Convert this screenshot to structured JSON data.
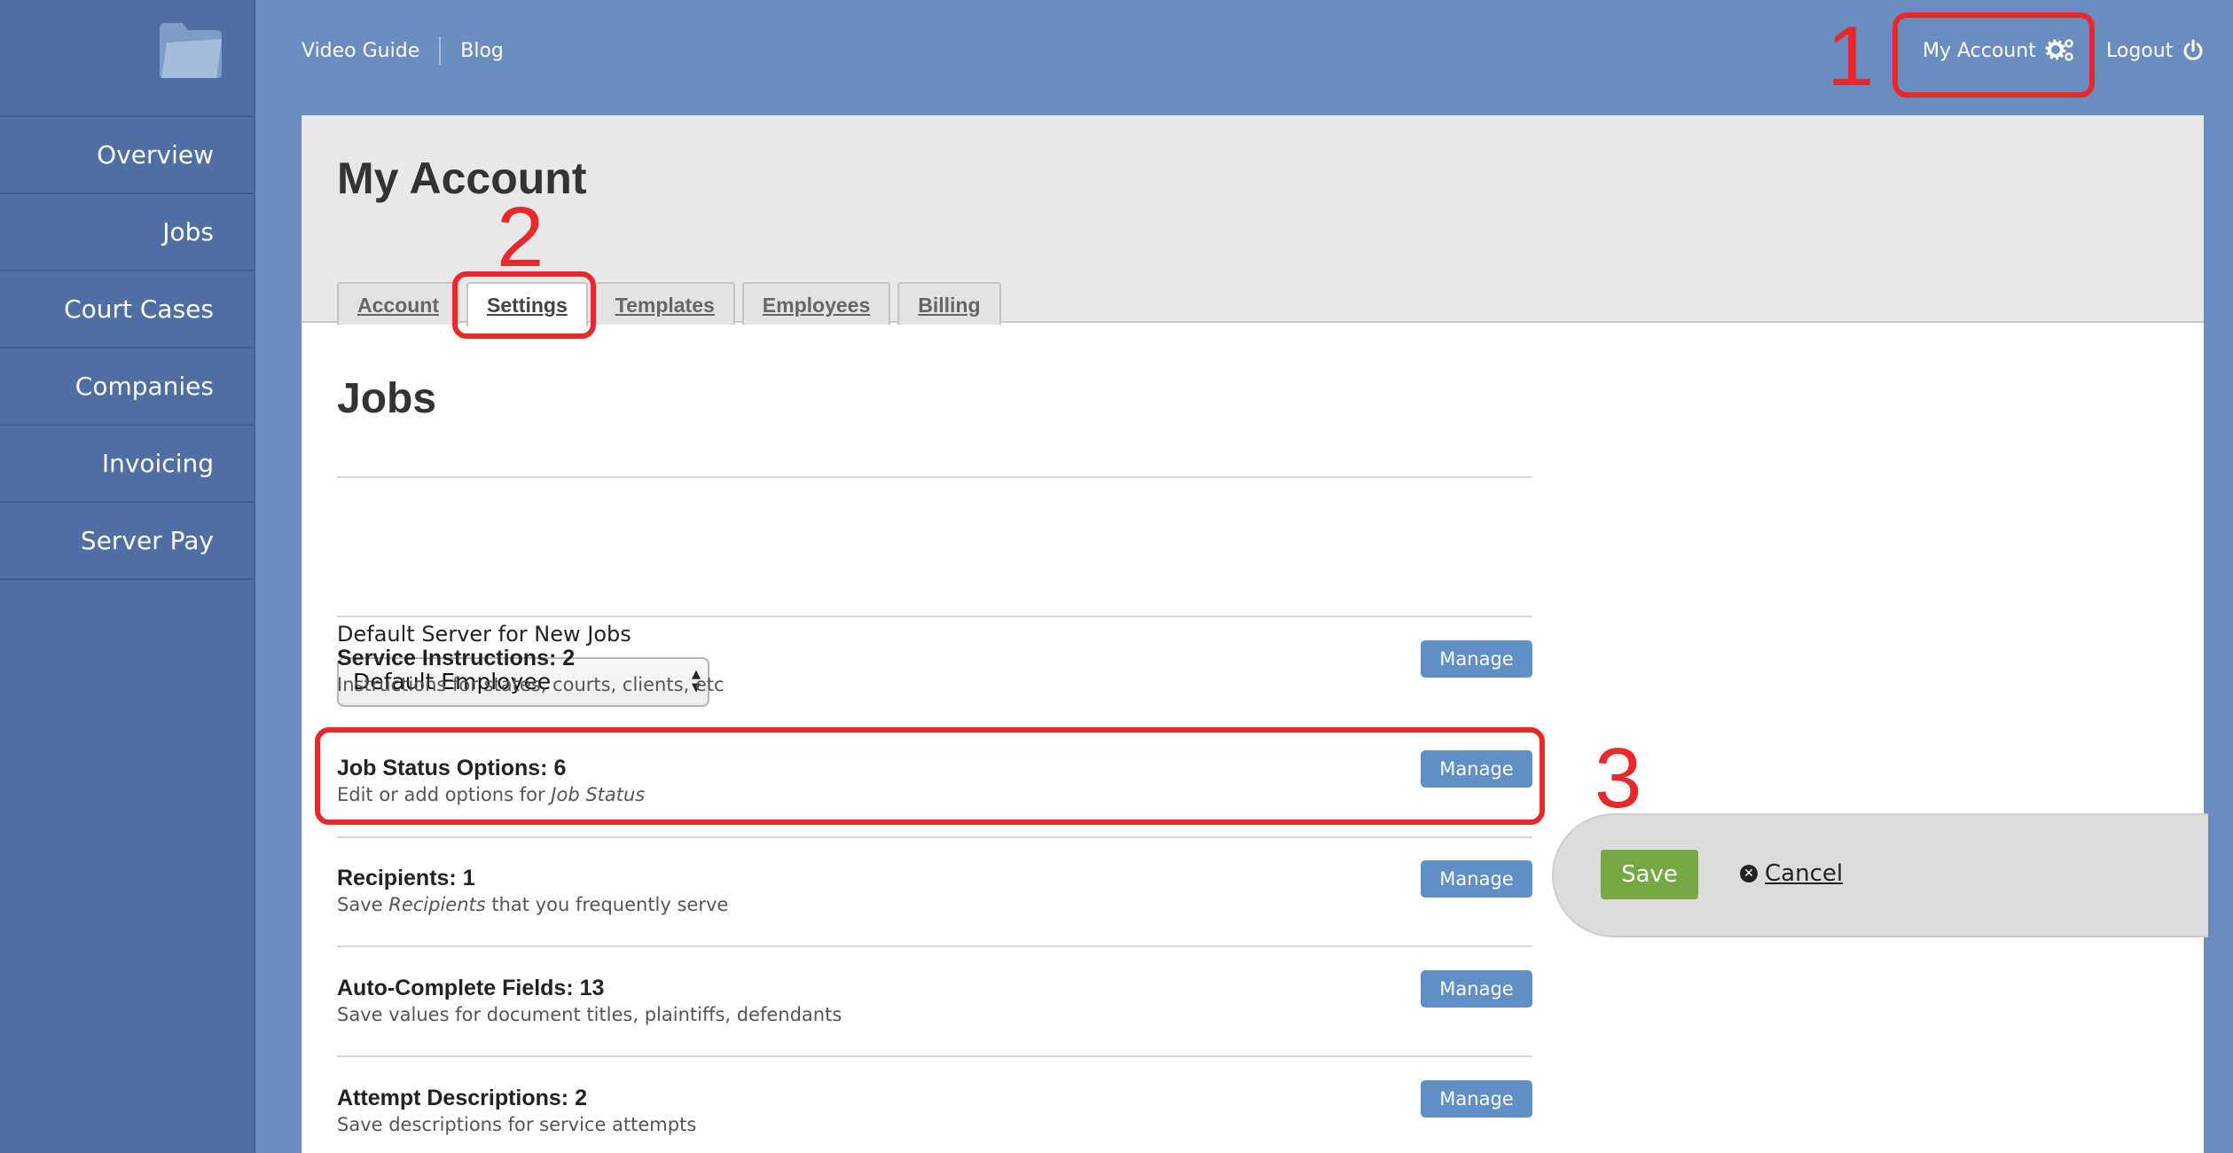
{
  "sidebar": {
    "logo_icon": "folder-icon",
    "items": [
      {
        "label": "Overview"
      },
      {
        "label": "Jobs"
      },
      {
        "label": "Court Cases"
      },
      {
        "label": "Companies"
      },
      {
        "label": "Invoicing"
      },
      {
        "label": "Server Pay"
      }
    ]
  },
  "topbar": {
    "video_guide": "Video Guide",
    "blog": "Blog",
    "my_account": "My Account",
    "my_account_icon": "gears-icon",
    "logout": "Logout",
    "logout_icon": "power-icon"
  },
  "page": {
    "title": "My Account",
    "tabs": [
      {
        "label": "Account",
        "active": false
      },
      {
        "label": "Settings",
        "active": true
      },
      {
        "label": "Templates",
        "active": false
      },
      {
        "label": "Employees",
        "active": false
      },
      {
        "label": "Billing",
        "active": false
      }
    ]
  },
  "jobs": {
    "section_title": "Jobs",
    "default_server": {
      "label": "Default Server for New Jobs",
      "value": "Default Employee"
    },
    "manage_label": "Manage",
    "options": [
      {
        "title": "Service Instructions: 2",
        "desc_pre": "Instructions for states, courts, clients, etc",
        "desc_em": "",
        "desc_post": ""
      },
      {
        "title": "Job Status Options: 6",
        "desc_pre": "Edit or add options for ",
        "desc_em": "Job Status",
        "desc_post": ""
      },
      {
        "title": "Recipients: 1",
        "desc_pre": "Save ",
        "desc_em": "Recipients",
        "desc_post": " that you frequently serve"
      },
      {
        "title": "Auto-Complete Fields: 13",
        "desc_pre": "Save values for document titles, plaintiffs, defendants",
        "desc_em": "",
        "desc_post": ""
      },
      {
        "title": "Attempt Descriptions: 2",
        "desc_pre": "Save descriptions for service attempts",
        "desc_em": "",
        "desc_post": ""
      }
    ]
  },
  "actions": {
    "save": "Save",
    "cancel": "Cancel",
    "cancel_icon": "close-circle-icon"
  },
  "annotations": {
    "color": "#e8282a",
    "labels": [
      "1",
      "2",
      "3"
    ]
  }
}
